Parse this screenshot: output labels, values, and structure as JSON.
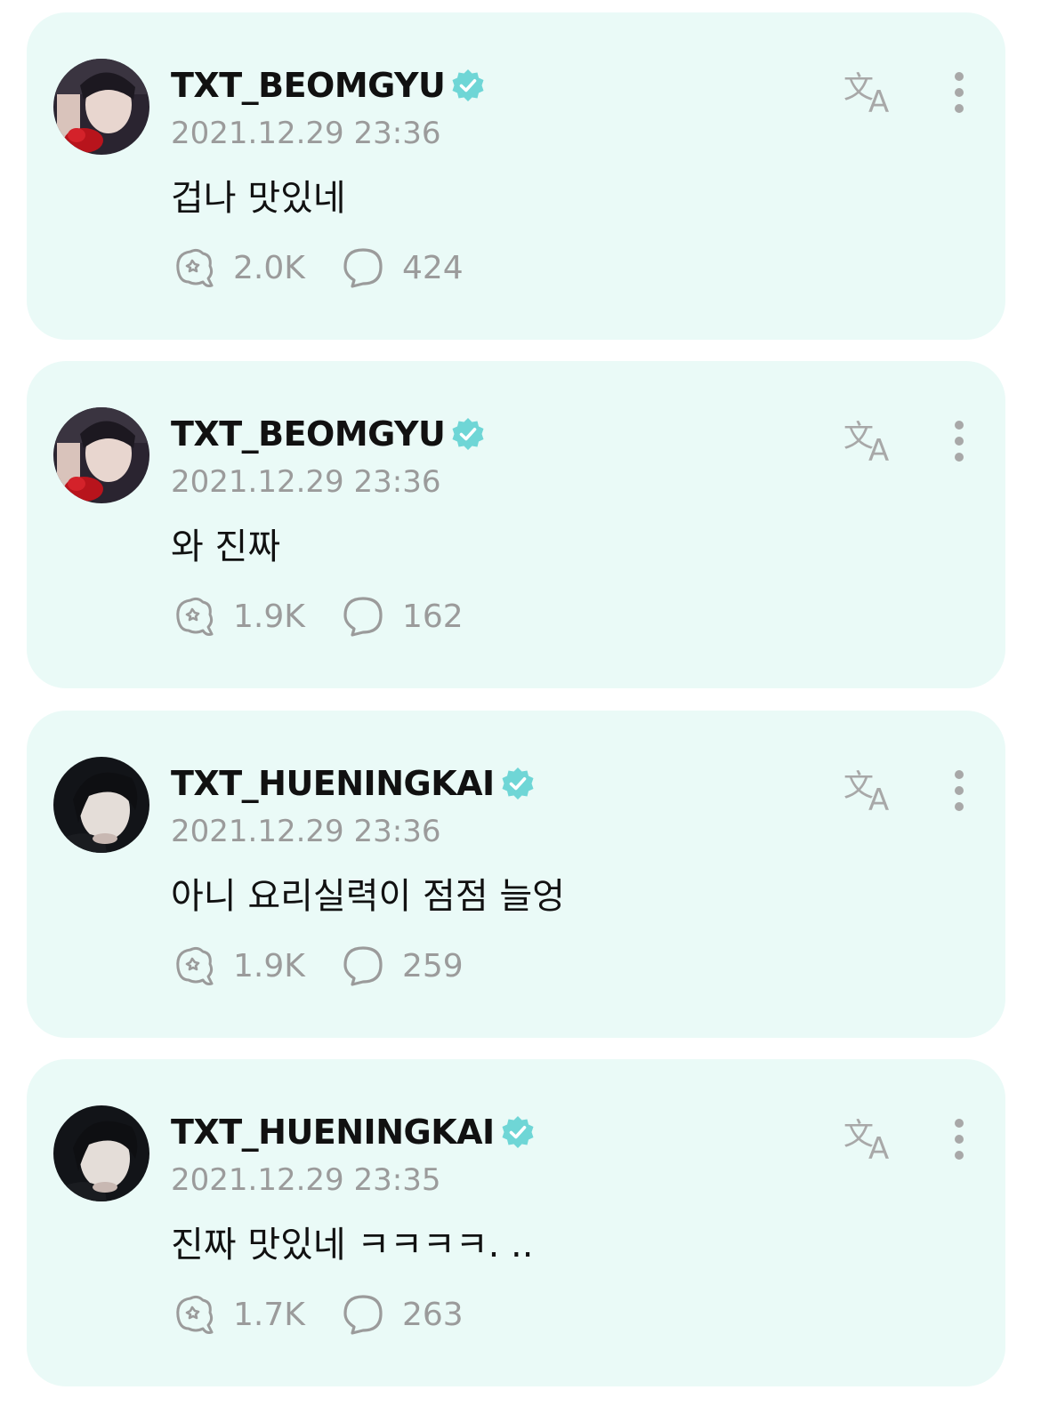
{
  "accent_color": "#6fd6d6",
  "card_background": "#eafaf7",
  "posts": [
    {
      "username": "TXT_BEOMGYU",
      "timestamp": "2021.12.29 23:36",
      "content": "겁나 맛있네",
      "likes": "2.0K",
      "comments": "424",
      "avatar": "beomgyu-avatar"
    },
    {
      "username": "TXT_BEOMGYU",
      "timestamp": "2021.12.29 23:36",
      "content": "와 진짜",
      "likes": "1.9K",
      "comments": "162",
      "avatar": "beomgyu-avatar"
    },
    {
      "username": "TXT_HUENINGKAI",
      "timestamp": "2021.12.29 23:36",
      "content": "아니 요리실력이 점점 늘엉",
      "likes": "1.9K",
      "comments": "259",
      "avatar": "hueningkai-avatar"
    },
    {
      "username": "TXT_HUENINGKAI",
      "timestamp": "2021.12.29 23:35",
      "content": "진짜 맛있네 ㅋㅋㅋㅋ. ..",
      "likes": "1.7K",
      "comments": "263",
      "avatar": "hueningkai-avatar"
    }
  ],
  "icons": {
    "verified": "verified-badge-icon",
    "translate": "translate-icon",
    "more": "more-vertical-icon",
    "like": "like-icon",
    "comment": "comment-icon"
  }
}
